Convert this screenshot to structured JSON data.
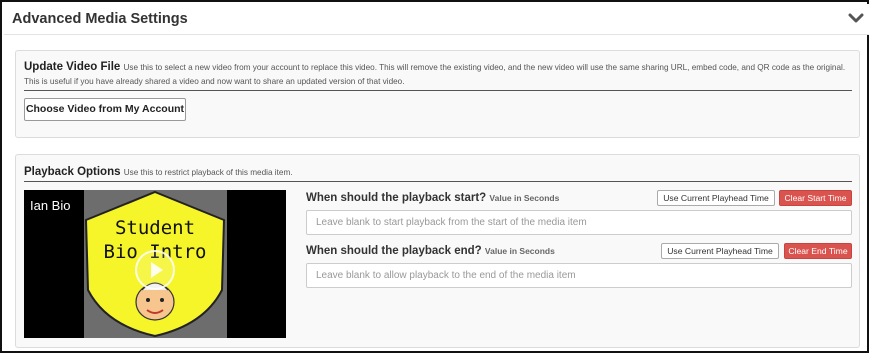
{
  "header": {
    "title": "Advanced Media Settings",
    "collapse_icon": "chevron-down-icon"
  },
  "update_video": {
    "heading": "Update Video File",
    "description": "Use this to select a new video from your account to replace this video. This will remove the existing video, and the new video will use the same sharing URL, embed code, and QR code as the original. This is useful if you have already shared a video and now want to share an updated version of that video.",
    "choose_button": "Choose Video from My Account"
  },
  "playback": {
    "heading": "Playback Options",
    "description": "Use this to restrict playback of this media item.",
    "video": {
      "title": "Ian Bio",
      "thumbnail_line1": "Student",
      "thumbnail_line2": "Bio Intro",
      "play_icon": "play-icon"
    },
    "start": {
      "label": "When should the playback start?",
      "unit": "Value in Seconds",
      "current_button": "Use Current Playhead Time",
      "clear_button": "Clear Start Time",
      "placeholder": "Leave blank to start playback from the start of the media item",
      "value": ""
    },
    "end": {
      "label": "When should the playback end?",
      "unit": "Value in Seconds",
      "current_button": "Use Current Playhead Time",
      "clear_button": "Clear End Time",
      "placeholder": "Leave blank to allow playback to the end of the media item",
      "value": ""
    }
  },
  "colors": {
    "danger": "#d9534f",
    "panel_bg": "#f9f9f9",
    "shield_yellow": "#f5f52a"
  }
}
